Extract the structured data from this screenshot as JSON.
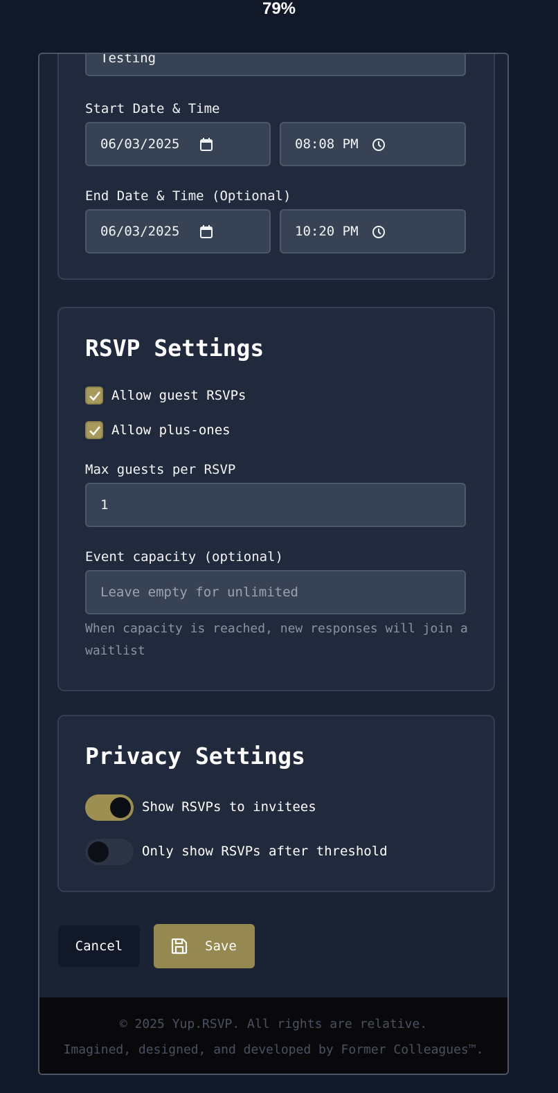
{
  "zoom": "79%",
  "event_form": {
    "title_value": "Testing",
    "start": {
      "label": "Start Date & Time",
      "date": "06/03/2025",
      "time": "08:08 PM"
    },
    "end": {
      "label": "End Date & Time (Optional)",
      "date": "06/03/2025",
      "time": "10:20 PM"
    }
  },
  "rsvp_settings": {
    "heading": "RSVP Settings",
    "allow_guest_rsvps": {
      "label": "Allow guest RSVPs",
      "checked": true
    },
    "allow_plus_ones": {
      "label": "Allow plus-ones",
      "checked": true
    },
    "max_guests": {
      "label": "Max guests per RSVP",
      "value": "1"
    },
    "capacity": {
      "label": "Event capacity (optional)",
      "placeholder": "Leave empty for unlimited",
      "help_line1": "When capacity is reached, new responses will join a",
      "help_line2": "waitlist"
    }
  },
  "privacy_settings": {
    "heading": "Privacy Settings",
    "show_rsvps": {
      "label": "Show RSVPs to invitees",
      "on": true
    },
    "threshold": {
      "label": "Only show RSVPs after threshold",
      "on": false
    }
  },
  "actions": {
    "cancel_label": "Cancel",
    "save_label": "Save"
  },
  "footer": {
    "line1": "© 2025 Yup.RSVP. All rights are relative.",
    "line2": "Imagined, designed, and developed by Former Colleagues™."
  },
  "colors": {
    "accent": "#958850",
    "page_bg": "#111827",
    "card_bg": "#202a3c"
  }
}
